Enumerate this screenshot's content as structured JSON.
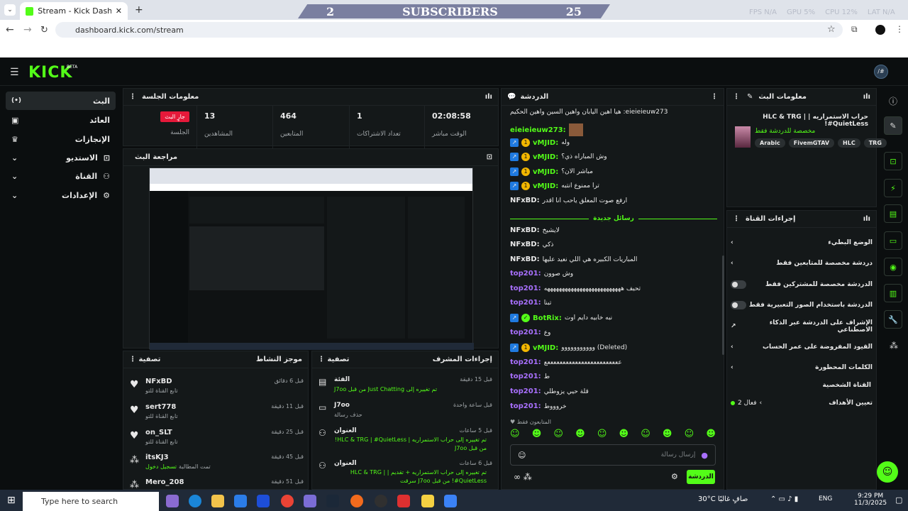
{
  "browser": {
    "tab_title": "Stream - Kick Dashboard",
    "url": "dashboard.kick.com/stream"
  },
  "overlay": {
    "left_num": "2",
    "title": "SUBSCRIBERS",
    "right_num": "25",
    "perf": [
      "FPS N/A",
      "GPU 5%",
      "CPU 12%",
      "LAT N/A"
    ]
  },
  "app": {
    "logo": "KICK",
    "beta": "BETA"
  },
  "sidebar": [
    {
      "label": "البث"
    },
    {
      "label": "العائد"
    },
    {
      "label": "الإنجازات"
    },
    {
      "label": "الاستديو"
    },
    {
      "label": "القناة"
    },
    {
      "label": "الإعدادات"
    }
  ],
  "session": {
    "title": "معلومات الجلسة",
    "live_badge": "جارٍ البث",
    "session_label": "الجلسة",
    "stats": [
      {
        "value": "13",
        "label": "المشاهدين"
      },
      {
        "value": "464",
        "label": "المتابعين"
      },
      {
        "value": "1",
        "label": "تعداد الاشتراكات"
      },
      {
        "value": "02:08:58",
        "label": "الوقت مباشر"
      }
    ]
  },
  "preview": {
    "title": "مراجعة البث"
  },
  "activity": {
    "title": "موجز النشاط",
    "filter": "تصفية",
    "items": [
      {
        "name": "NFxBD",
        "sub": "تابع القناة للتو",
        "time": "قبل 6 دقائق"
      },
      {
        "name": "sert778",
        "sub": "تابع القناة للتو",
        "time": "قبل 11 دقيقة"
      },
      {
        "name": "on_SLT",
        "sub": "تابع القناة للتو",
        "time": "قبل 25 دقيقة"
      },
      {
        "name": "itsKJ3",
        "sub": "تمت المطالبة",
        "sub2": "تسجيل دخول",
        "time": "قبل 45 دقيقة"
      },
      {
        "name": "Mero_208",
        "sub": "",
        "time": "قبل 51 دقيقة"
      }
    ]
  },
  "modactions": {
    "title": "إجراءات المشرف",
    "filter": "تصفية",
    "items": [
      {
        "head": "الفئة",
        "line": "تم تغييره إلى Just Chatting من قبل J7oo",
        "time": "قبل 15 دقيقة"
      },
      {
        "head": "J7oo",
        "line": "حذف رسالة",
        "time": "قبل ساعة واحدة"
      },
      {
        "head": "العنوان",
        "line": "تم تغييره إلى حراب الاستمراريه | HLC & TRG | #QuietLess! من قبل J7oo",
        "time": "قبل 5 ساعات"
      },
      {
        "head": "العنوان",
        "line": "تم تغييره إلى حراب الاستمراريه + تقديم | HLC & TRG | #QuietLess! من قبل J7oo سرقت",
        "time": "قبل 6 ساعات"
      }
    ]
  },
  "chat": {
    "title": "الدردشة",
    "new_messages": "رسائل جديدة",
    "followers_only": "المتابعون فقط",
    "input_placeholder": "إرسال رسالة",
    "send": "الدردشة",
    "messages": [
      {
        "name": "",
        "text": "هيا اهين اليابان واهين السين واهين الحكيم :eieieieuw273",
        "color": "#e8e8e8"
      },
      {
        "name": "eieieieuw273:",
        "text": "",
        "color": "#53fc18"
      },
      {
        "name": "vMJID:",
        "text": "وله",
        "color": "#53fc18"
      },
      {
        "name": "vMJID:",
        "text": "وش المباراه ذي؟",
        "color": "#53fc18"
      },
      {
        "name": "vMJID:",
        "text": "مباشر الان؟",
        "color": "#53fc18"
      },
      {
        "name": "vMJID:",
        "text": "ترا ممنوع انتبه",
        "color": "#53fc18"
      },
      {
        "name": "NFxBD:",
        "text": "ارفع صوت المعلق ياحب انا اقدر",
        "color": "#e8e8e8"
      },
      {
        "name": "NFxBD:",
        "text": "لايشيخ",
        "color": "#e8e8e8"
      },
      {
        "name": "NFxBD:",
        "text": "ذكي",
        "color": "#e8e8e8"
      },
      {
        "name": "NFxBD:",
        "text": "المباريات الكبيره هي اللي نعيد عليها",
        "color": "#e8e8e8"
      },
      {
        "name": "top201:",
        "text": "وش صوون",
        "color": "#a970ff"
      },
      {
        "name": "top201:",
        "text": "تحيف ههههههههههههههههههههههههههه",
        "color": "#a970ff"
      },
      {
        "name": "top201:",
        "text": "تبنا",
        "color": "#a970ff"
      },
      {
        "name": "BotRix:",
        "text": "نبه خابيه دايم اوت",
        "color": "#53fc18"
      },
      {
        "name": "top201:",
        "text": "وع",
        "color": "#a970ff"
      },
      {
        "name": "vMJID:",
        "text": "ووووووووووو (Deleted)",
        "color": "#53fc18"
      },
      {
        "name": "top201:",
        "text": "ععععععععععععععععععععععععع",
        "color": "#a970ff"
      },
      {
        "name": "top201:",
        "text": "ط",
        "color": "#a970ff"
      },
      {
        "name": "top201:",
        "text": "قلة حيي يزوطلي",
        "color": "#a970ff"
      },
      {
        "name": "top201:",
        "text": "خروووط",
        "color": "#a970ff"
      }
    ]
  },
  "streaminfo": {
    "title": "معلومات البث",
    "stream_title": "حراب الاستمراريه | HLC & TRG | #QuietLess!",
    "subtitle": "مخصصة للدردشة فقط",
    "tags": [
      "Arabic",
      "FivemGTAV",
      "HLC",
      "TRG"
    ]
  },
  "channelactions": {
    "title": "إجراءات القناة",
    "rows": [
      {
        "label": "الوضع البطيء",
        "kind": "arrow"
      },
      {
        "label": "دردشة مخصصة للمتابعين فقط",
        "kind": "arrow"
      },
      {
        "label": "الدردشة مخصصة للمشتركين فقط",
        "kind": "toggle"
      },
      {
        "label": "الدردشة باستخدام الصور التعبيرية فقط",
        "kind": "toggle"
      },
      {
        "label": "الإشراف على الدردشة عبر الذكاء الاصطناعي",
        "kind": "ext"
      },
      {
        "label": "القيود المفروضة على عمر الحساب",
        "kind": "arrow"
      },
      {
        "label": "الكلمات المحظورة",
        "kind": "arrow"
      }
    ],
    "section": "القناة الشخصية",
    "goals": "تعيين الأهداف",
    "goals_value": "فعال 2"
  },
  "taskbar": {
    "search": "Type here to search",
    "weather": "30°C صافٍ غالبًا",
    "lang": "ENG",
    "time": "9:29 PM",
    "date": "11/3/2025"
  },
  "colors": {
    "accent": "#53fc18",
    "live": "#e5193a",
    "purple": "#a970ff"
  }
}
